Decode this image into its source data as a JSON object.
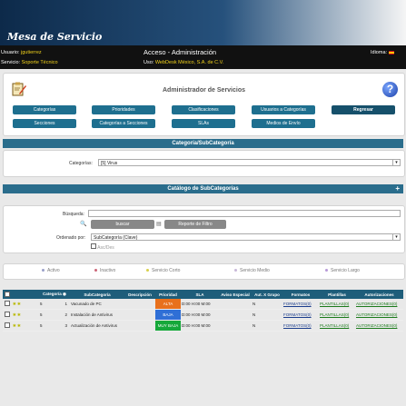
{
  "header": {
    "brand": "Mesa de Servicio",
    "user_label": "Usuario:",
    "user_value": "jgutierrez",
    "service_label": "Servicio:",
    "service_value": "Soporte Técnico",
    "access": "Acceso - Administración",
    "use_label": "Uso:",
    "use_value": "WebDesk México, S.A. de C.V.",
    "language_label": "Idioma:"
  },
  "admin": {
    "title": "Administrador de Servicios",
    "buttons": [
      "Categorías",
      "Prioridades",
      "Clasificaciones",
      "Usuarios a Categorías",
      "Regresar",
      "Secciones",
      "Categorías a Secciones",
      "SLAs",
      "Medios de Envío"
    ]
  },
  "category_section": {
    "header": "Categoría/SubCategoría",
    "label": "Categorías:",
    "value": "[5] Virus"
  },
  "catalog_section": {
    "header": "Catálogo de SubCategorías",
    "search_label": "Búsqueda:",
    "search_button": "buscar",
    "report_button": "Reporte de Filtro",
    "order_label": "Ordenado por:",
    "order_value": "SubCategoría (Clave)",
    "asc_desc": "Asc/Des"
  },
  "legend": [
    "Activo",
    "Inactivo",
    "Servicio Corto",
    "Servicio Medio",
    "Servicio Largo"
  ],
  "colors": {
    "activo": "#9aa0c8",
    "inactivo": "#cc6677",
    "corto": "#d8d04a",
    "medio": "#c8b8d8",
    "largo": "#b89ad8",
    "alta": "#e8701c",
    "baja": "#2f6fd6",
    "muy_baja": "#16a83a"
  },
  "table": {
    "columns": [
      "Categoría",
      "SubCategoría",
      "Descripción",
      "Prioridad",
      "SLA",
      "Aviso Especial",
      "Aut. X Grupo",
      "Formatos",
      "Plantillas",
      "Autorizaciones"
    ],
    "rows": [
      {
        "cat": "5",
        "num": "1",
        "sub": "Vacunado de PC",
        "desc": "",
        "prio": "ALTA",
        "sla": "D:00 H:00 M:00",
        "aviso": "",
        "aut": "N",
        "formatos": "FORMATOS(0)",
        "plantillas": "PLANTILLAS(0)",
        "autorizaciones": "AUTORIZACIONES(0)"
      },
      {
        "cat": "5",
        "num": "2",
        "sub": "Instalación de Antivirus",
        "desc": "",
        "prio": "BAJA",
        "sla": "D:00 H:00 M:00",
        "aviso": "",
        "aut": "N",
        "formatos": "FORMATOS(0)",
        "plantillas": "PLANTILLAS(0)",
        "autorizaciones": "AUTORIZACIONES(0)"
      },
      {
        "cat": "5",
        "num": "3",
        "sub": "Actualización de Antivirus",
        "desc": "",
        "prio": "MUY BAJA",
        "sla": "D:00 H:00 M:00",
        "aviso": "",
        "aut": "N",
        "formatos": "FORMATOS(0)",
        "plantillas": "PLANTILLAS(0)",
        "autorizaciones": "AUTORIZACIONES(0)"
      }
    ]
  }
}
